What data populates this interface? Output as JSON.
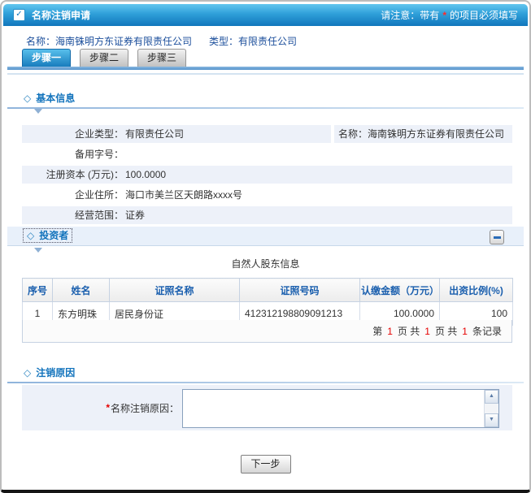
{
  "icons": {
    "diamond": "◇",
    "check": "✓",
    "scroll_up": "▲",
    "scroll_down": "▼"
  },
  "colors": {
    "titlebar_gradient_top": "#63c6ef",
    "titlebar_gradient_bottom": "#1176bc",
    "section_title_blue": "#1273bc",
    "company_text_blue": "#1b4e9b",
    "row_shade": "#edf1f9",
    "required_star_red": "#e60000",
    "pagination_number_red": "#e60000",
    "table_header_blue": "#1a5fae"
  },
  "header": {
    "title": "名称注销申请",
    "notice_prefix": "请注意：带有",
    "notice_star": "*",
    "notice_suffix": "的项目必须填写"
  },
  "company": {
    "name_label": "名称：",
    "name_value": "海南铢明方东证券有限责任公司",
    "type_label": "类型：",
    "type_value": "有限责任公司"
  },
  "tabs": [
    {
      "label": "步骤一",
      "active": true
    },
    {
      "label": "步骤二",
      "active": false
    },
    {
      "label": "步骤三",
      "active": false
    }
  ],
  "basic": {
    "title": "基本信息",
    "rows": [
      {
        "label": "企业类型：",
        "value": "有限责任公司",
        "label_right": "名称：",
        "value_right": "海南铢明方东证券有限责任公司"
      },
      {
        "label": "备用字号：",
        "value": ""
      },
      {
        "label": "注册资本 (万元)：",
        "value": "100.0000"
      },
      {
        "label": "企业住所：",
        "value": "海口市美兰区天朗路xxxx号"
      },
      {
        "label": "经营范围：",
        "value": "证券"
      }
    ]
  },
  "investors": {
    "title": "投资者",
    "table_title": "自然人股东信息",
    "headers": [
      "序号",
      "姓名",
      "证照名称",
      "证照号码",
      "认缴金额（万元）",
      "出资比例(%)"
    ],
    "rows": [
      [
        "1",
        "东方明珠",
        "居民身份证",
        "412312198809091213",
        "100.0000",
        "100"
      ]
    ],
    "pagination_parts": [
      "第",
      "1",
      "页 共",
      "1",
      "页 共",
      "1",
      "条记录"
    ]
  },
  "reason": {
    "title": "注销原因",
    "required_star": "*",
    "field_label": "名称注销原因：",
    "value": ""
  },
  "footer": {
    "next_label": "下一步"
  }
}
